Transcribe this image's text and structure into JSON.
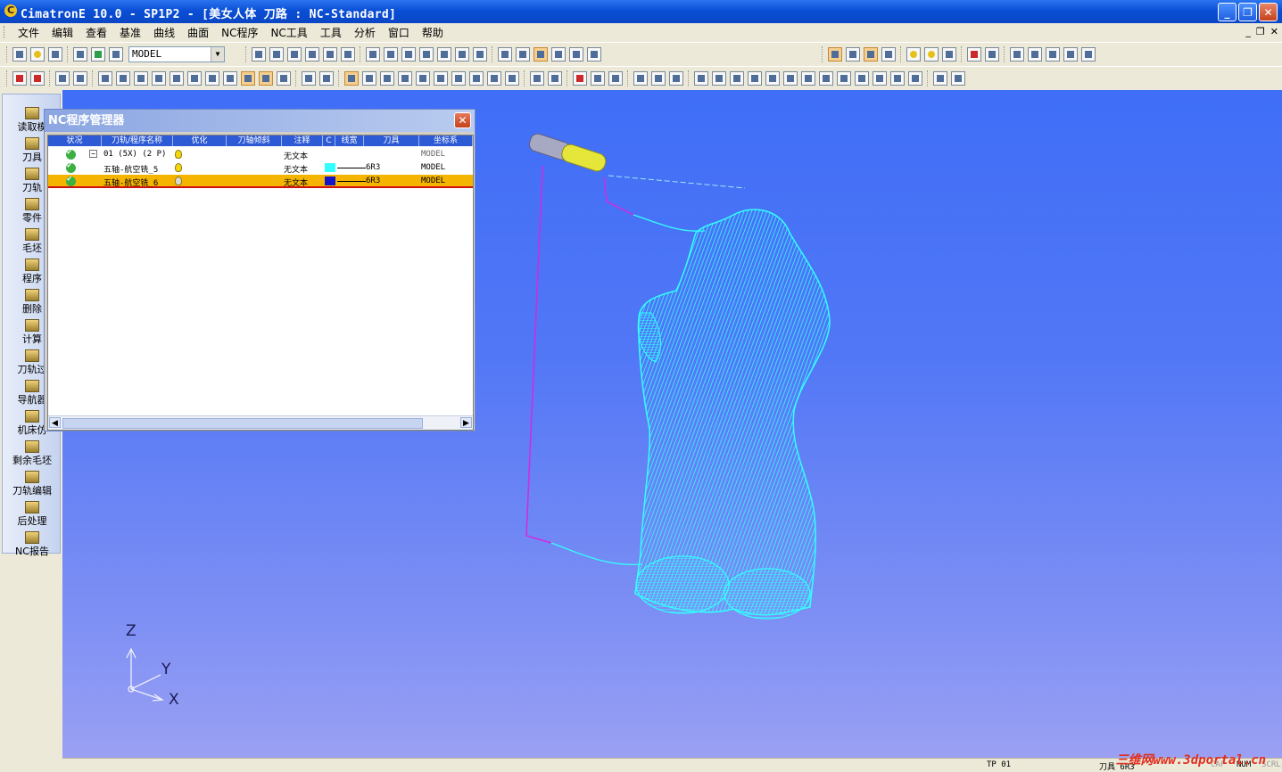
{
  "window": {
    "title": "CimatronE 10.0 - SP1P2 - [美女人体 刀路 : NC-Standard]",
    "minimize": "_",
    "maximize": "❐",
    "close": "✕"
  },
  "menu": [
    "文件",
    "编辑",
    "查看",
    "基准",
    "曲线",
    "曲面",
    "NC程序",
    "NC工具",
    "工具",
    "分析",
    "窗口",
    "帮助"
  ],
  "mdi_controls": [
    "_",
    "❐",
    "✕"
  ],
  "toolbar": {
    "model_combo": "MODEL"
  },
  "sidebar": [
    "读取模",
    "刀具",
    "刀轨",
    "零件",
    "毛坯",
    "程序",
    "删除",
    "计算",
    "刀轨过",
    "导航器",
    "机床仿",
    "剩余毛坯",
    "刀轨编辑",
    "后处理",
    "NC报告"
  ],
  "nc_dialog": {
    "title": "NC程序管理器",
    "close": "✕",
    "columns": [
      "状况",
      "刀轨/程序名称",
      "优化",
      "刀轴倾斜",
      "注释",
      "C",
      "线宽",
      "刀具",
      "坐标系"
    ],
    "rows": [
      {
        "name": "01 (5X) (2 P)",
        "comment": "无文本",
        "tool": "",
        "cs": "MODEL",
        "color": "",
        "selected": false,
        "tree": "−"
      },
      {
        "name": "五轴-航空铣_5",
        "comment": "无文本",
        "tool": "6R3",
        "cs": "MODEL",
        "color": "#33ffff",
        "selected": false
      },
      {
        "name": "五轴-航空铣_6",
        "comment": "无文本",
        "tool": "6R3",
        "cs": "MODEL",
        "color": "#1414c8",
        "selected": true
      }
    ]
  },
  "axes": {
    "z": "Z",
    "y": "Y",
    "x": "X"
  },
  "status": {
    "left": "TP 01",
    "tool": "刀具 6R3",
    "cap": "CAP",
    "num": "NUM",
    "scrl": "SCRL"
  },
  "watermark": "三维网www.3dportal.cn",
  "colors": {
    "toolpath": "#33ffff",
    "titlebar": "#0a4fd6",
    "viewport_top": "#3f6ef7",
    "viewport_bottom": "#9aa0f3",
    "selected_row": "#f5b400"
  }
}
